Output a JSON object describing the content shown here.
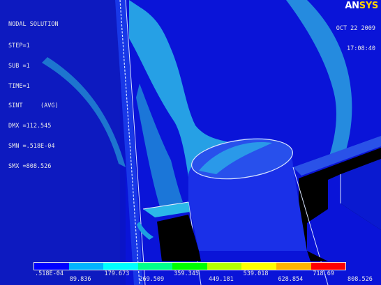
{
  "header": {
    "title": "NODAL SOLUTION",
    "lines": [
      "STEP=1",
      "SUB =1",
      "TIME=1",
      "SINT     (AVG)",
      "DMX =112.545",
      "SMN =.518E-04",
      "SMX =808.526"
    ]
  },
  "timestamp": {
    "date": "OCT 22 2009",
    "time": "17:08:40"
  },
  "logo": {
    "an": "AN",
    "sys": "SYS"
  },
  "legend": {
    "colors": [
      "#0000ff",
      "#00b4ff",
      "#00ffff",
      "#00ff8c",
      "#00ff00",
      "#b4ff00",
      "#ffff00",
      "#ffb400",
      "#ff0000"
    ],
    "labels_bottom": [
      ".518E-04",
      "179.673",
      "359.345",
      "539.018",
      "718.69"
    ],
    "labels_top": [
      "89.836",
      "269.509",
      "449.181",
      "628.854",
      "808.526"
    ]
  },
  "colors": {
    "background_blue": "#0a14c8",
    "light_cyan": "#2bb8e8",
    "mid_blue": "#1848d8",
    "black": "#000000"
  }
}
